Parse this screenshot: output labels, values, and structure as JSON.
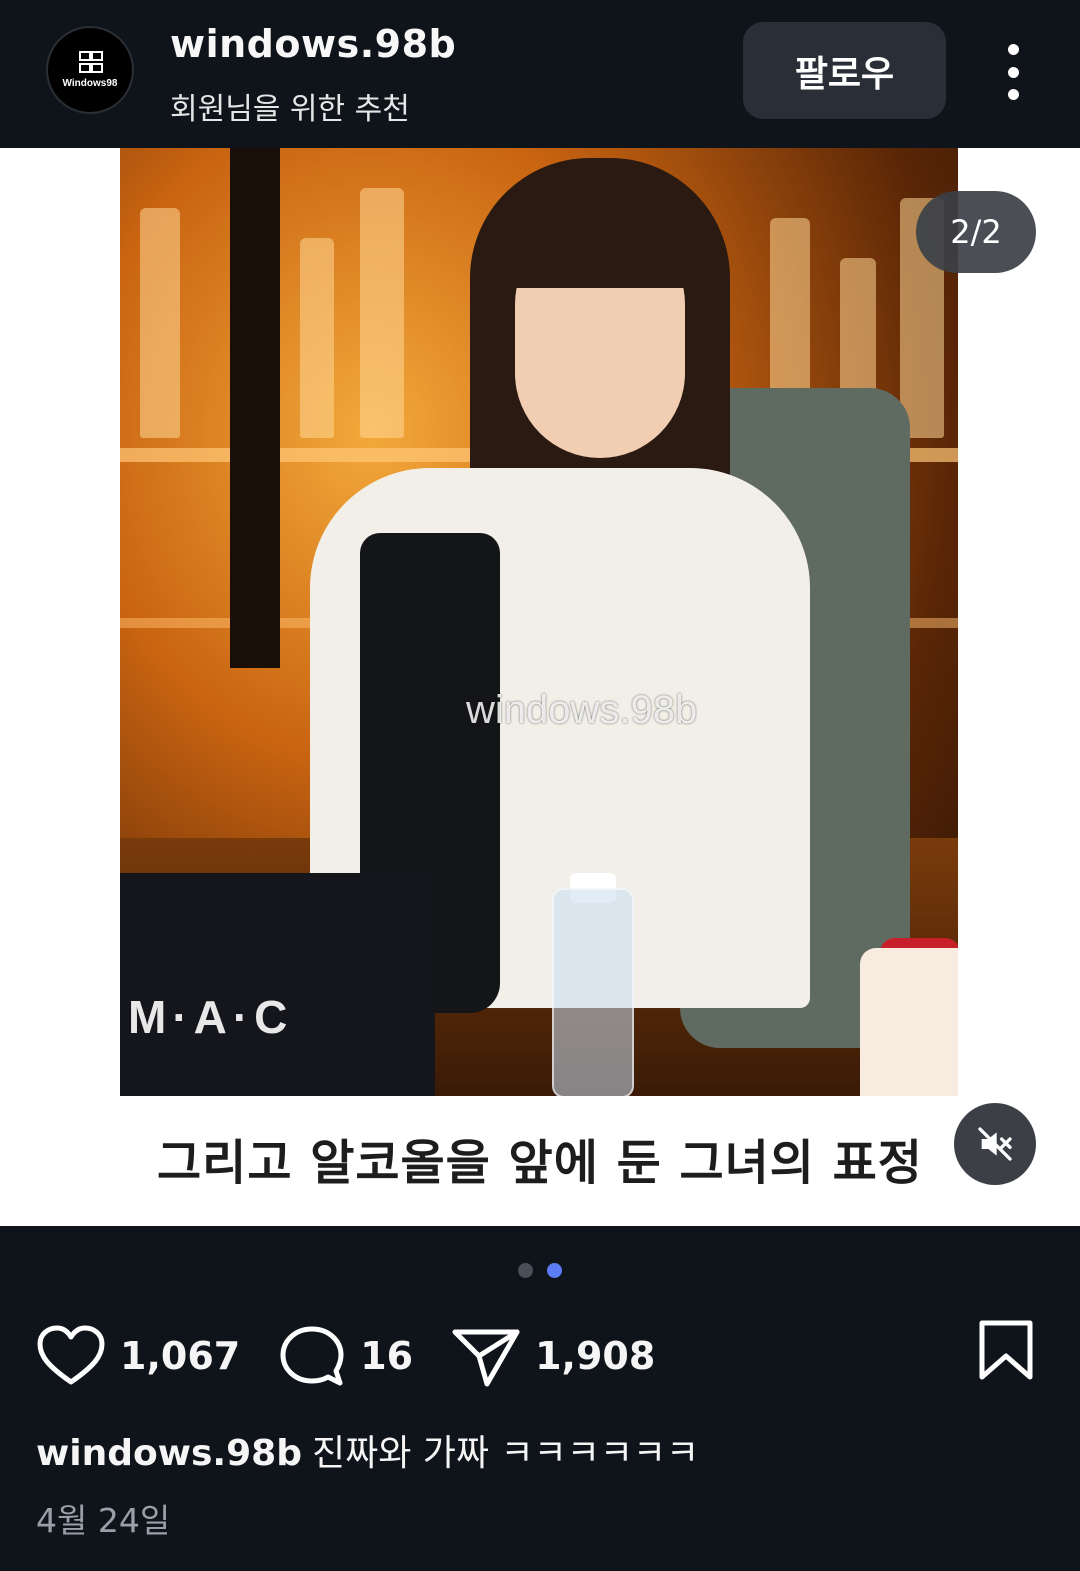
{
  "header": {
    "avatar_logo_text": "Windows98",
    "username": "windows.98b",
    "subtitle": "회원님을 위한 추천",
    "follow_label": "팔로우",
    "more_icon": "more-vertical-icon"
  },
  "media": {
    "counter": "2/2",
    "watermark": "windows.98b",
    "bag_text": "M·A·C",
    "caption_text": "그리고 알코올을 앞에 둔 그녀의 표정",
    "mute_icon": "speaker-muted-icon"
  },
  "carousel": {
    "total": 2,
    "active_index": 1,
    "active_color": "#5b7cf5"
  },
  "actions": {
    "likes": "1,067",
    "comments": "16",
    "shares": "1,908"
  },
  "post": {
    "username": "windows.98b",
    "caption": "진짜와 가짜 ㅋㅋㅋㅋㅋㅋ",
    "date": "4월 24일"
  }
}
